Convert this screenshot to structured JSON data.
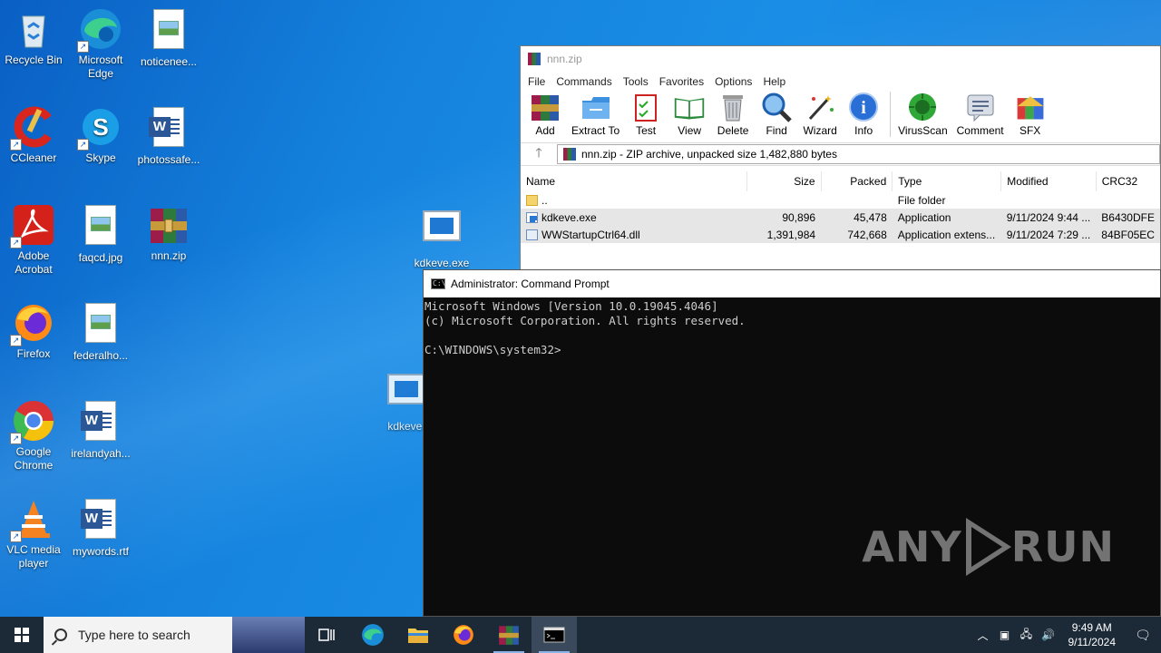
{
  "desktop": {
    "icons": [
      {
        "label": "Recycle Bin"
      },
      {
        "label": "Microsoft Edge"
      },
      {
        "label": "noticenee..."
      },
      {
        "label": "CCleaner"
      },
      {
        "label": "Skype"
      },
      {
        "label": "photossafe..."
      },
      {
        "label": "Adobe Acrobat"
      },
      {
        "label": "faqcd.jpg"
      },
      {
        "label": "nnn.zip"
      },
      {
        "label": "Firefox"
      },
      {
        "label": "federalho..."
      },
      {
        "label": "Google Chrome"
      },
      {
        "label": "irelandyah..."
      },
      {
        "label": "VLC media player"
      },
      {
        "label": "mywords.rtf"
      },
      {
        "label": "kdkeve.exe"
      },
      {
        "label": "kdkeve."
      }
    ]
  },
  "winrar": {
    "title": "nnn.zip",
    "menu": [
      "File",
      "Commands",
      "Tools",
      "Favorites",
      "Options",
      "Help"
    ],
    "toolbar": [
      {
        "label": "Add",
        "icon": "add-icon"
      },
      {
        "label": "Extract To",
        "icon": "extract-icon"
      },
      {
        "label": "Test",
        "icon": "test-icon"
      },
      {
        "label": "View",
        "icon": "view-icon"
      },
      {
        "label": "Delete",
        "icon": "delete-icon"
      },
      {
        "label": "Find",
        "icon": "find-icon"
      },
      {
        "label": "Wizard",
        "icon": "wizard-icon"
      },
      {
        "label": "Info",
        "icon": "info-icon"
      },
      {
        "label": "VirusScan",
        "icon": "virusscan-icon"
      },
      {
        "label": "Comment",
        "icon": "comment-icon"
      },
      {
        "label": "SFX",
        "icon": "sfx-icon"
      }
    ],
    "address": "nnn.zip - ZIP archive, unpacked size 1,482,880 bytes",
    "columns": {
      "name": "Name",
      "size": "Size",
      "packed": "Packed",
      "type": "Type",
      "modified": "Modified",
      "crc": "CRC32"
    },
    "rows": [
      {
        "name": "..",
        "size": "",
        "packed": "",
        "type": "File folder",
        "modified": "",
        "crc": ""
      },
      {
        "name": "kdkeve.exe",
        "size": "90,896",
        "packed": "45,478",
        "type": "Application",
        "modified": "9/11/2024 9:44 ...",
        "crc": "B6430DFE"
      },
      {
        "name": "WWStartupCtrl64.dll",
        "size": "1,391,984",
        "packed": "742,668",
        "type": "Application extens...",
        "modified": "9/11/2024 7:29 ...",
        "crc": "84BF05EC"
      }
    ]
  },
  "cmd": {
    "title": "Administrator: Command Prompt",
    "lines": [
      "Microsoft Windows [Version 10.0.19045.4046]",
      "(c) Microsoft Corporation. All rights reserved.",
      "",
      "C:\\WINDOWS\\system32>"
    ],
    "watermark": "ANY RUN"
  },
  "taskbar": {
    "search_placeholder": "Type here to search",
    "time": "9:49 AM",
    "date": "9/11/2024"
  }
}
